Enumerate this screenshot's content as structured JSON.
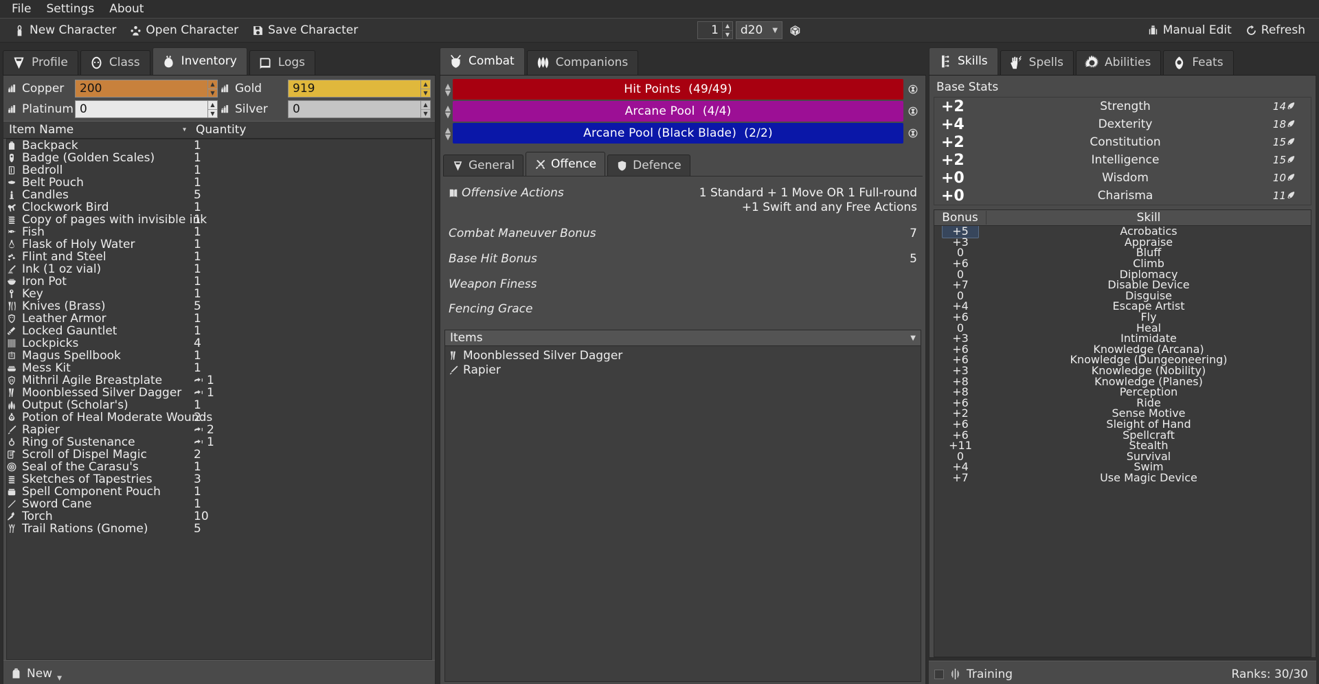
{
  "menubar": {
    "items": [
      {
        "label": "File"
      },
      {
        "label": "Settings"
      },
      {
        "label": "About"
      }
    ]
  },
  "toolbar": {
    "new_character": "New Character",
    "open_character": "Open Character",
    "save_character": "Save Character",
    "dice_count": "1",
    "dice_type": "d20",
    "manual_edit": "Manual Edit",
    "refresh": "Refresh"
  },
  "left_panel": {
    "tabs": [
      {
        "label": "Profile",
        "icon": "helmet-icon",
        "active": false
      },
      {
        "label": "Class",
        "icon": "hood-icon",
        "active": false
      },
      {
        "label": "Inventory",
        "icon": "sack-icon",
        "active": true
      },
      {
        "label": "Logs",
        "icon": "book-icon",
        "active": false
      }
    ],
    "currency": [
      {
        "label": "Copper",
        "value": "200",
        "color": "#c8813c",
        "icon": "coins-icon"
      },
      {
        "label": "Gold",
        "value": "919",
        "color": "#e0b83c",
        "icon": "coins-icon"
      },
      {
        "label": "Platinum",
        "value": "0",
        "color": "#e8e8e8",
        "icon": "coins-icon"
      },
      {
        "label": "Silver",
        "value": "0",
        "color": "#c4c4c4",
        "icon": "coins-icon"
      }
    ],
    "columns": {
      "name": "Item Name",
      "quantity": "Quantity"
    },
    "items": [
      {
        "name": "Backpack",
        "qty": "1",
        "equipped": false,
        "icon": "backpack-icon"
      },
      {
        "name": "Badge (Golden Scales)",
        "qty": "1",
        "equipped": false,
        "icon": "badge-icon"
      },
      {
        "name": "Bedroll",
        "qty": "1",
        "equipped": false,
        "icon": "bedroll-icon"
      },
      {
        "name": "Belt Pouch",
        "qty": "1",
        "equipped": false,
        "icon": "pouch-icon"
      },
      {
        "name": "Candles",
        "qty": "5",
        "equipped": false,
        "icon": "candle-icon"
      },
      {
        "name": "Clockwork Bird",
        "qty": "1",
        "equipped": false,
        "icon": "bird-icon"
      },
      {
        "name": "Copy of pages with invisible ink",
        "qty": "1",
        "equipped": false,
        "icon": "pages-icon"
      },
      {
        "name": "Fish",
        "qty": "1",
        "equipped": false,
        "icon": "fish-icon"
      },
      {
        "name": "Flask of Holy Water",
        "qty": "1",
        "equipped": false,
        "icon": "flask-icon"
      },
      {
        "name": "Flint and Steel",
        "qty": "1",
        "equipped": false,
        "icon": "flint-icon"
      },
      {
        "name": "Ink (1 oz vial)",
        "qty": "1",
        "equipped": false,
        "icon": "ink-icon"
      },
      {
        "name": "Iron Pot",
        "qty": "1",
        "equipped": false,
        "icon": "pot-icon"
      },
      {
        "name": "Key",
        "qty": "1",
        "equipped": false,
        "icon": "key-icon"
      },
      {
        "name": "Knives (Brass)",
        "qty": "5",
        "equipped": false,
        "icon": "knives-icon"
      },
      {
        "name": "Leather Armor",
        "qty": "1",
        "equipped": false,
        "icon": "armor-icon"
      },
      {
        "name": "Locked Gauntlet",
        "qty": "1",
        "equipped": false,
        "icon": "gauntlet-icon"
      },
      {
        "name": "Lockpicks",
        "qty": "4",
        "equipped": false,
        "icon": "lockpicks-icon"
      },
      {
        "name": "Magus Spellbook",
        "qty": "1",
        "equipped": false,
        "icon": "spellbook-icon"
      },
      {
        "name": "Mess Kit",
        "qty": "1",
        "equipped": false,
        "icon": "messkit-icon"
      },
      {
        "name": "Mithril Agile Breastplate",
        "qty": "1",
        "equipped": true,
        "icon": "breastplate-icon"
      },
      {
        "name": "Moonblessed Silver Dagger",
        "qty": "1",
        "equipped": true,
        "icon": "dagger-icon"
      },
      {
        "name": "Output (Scholar's)",
        "qty": "1",
        "equipped": false,
        "icon": "quill-icon"
      },
      {
        "name": "Potion of Heal Moderate Wounds",
        "qty": "2",
        "equipped": false,
        "icon": "potion-icon"
      },
      {
        "name": "Rapier",
        "qty": "2",
        "equipped": true,
        "icon": "rapier-icon"
      },
      {
        "name": "Ring of Sustenance",
        "qty": "1",
        "equipped": true,
        "icon": "ring-icon"
      },
      {
        "name": "Scroll of Dispel Magic",
        "qty": "2",
        "equipped": false,
        "icon": "scroll-icon"
      },
      {
        "name": "Seal of the Carasu's",
        "qty": "1",
        "equipped": false,
        "icon": "seal-icon"
      },
      {
        "name": "Sketches of Tapestries",
        "qty": "3",
        "equipped": false,
        "icon": "pages-icon"
      },
      {
        "name": "Spell Component Pouch",
        "qty": "1",
        "equipped": false,
        "icon": "component-pouch-icon"
      },
      {
        "name": "Sword Cane",
        "qty": "1",
        "equipped": false,
        "icon": "cane-icon"
      },
      {
        "name": "Torch",
        "qty": "10",
        "equipped": false,
        "icon": "torch-icon"
      },
      {
        "name": "Trail Rations (Gnome)",
        "qty": "5",
        "equipped": false,
        "icon": "rations-icon"
      }
    ],
    "new_button": "New"
  },
  "mid_panel": {
    "tabs": [
      {
        "label": "Combat",
        "icon": "shield-swords-icon",
        "active": true
      },
      {
        "label": "Companions",
        "icon": "leaves-icon",
        "active": false
      }
    ],
    "resources": [
      {
        "label": "Hit Points",
        "value": "(49/49)",
        "color": "#a80010"
      },
      {
        "label": "Arcane Pool",
        "value": "(4/4)",
        "color": "#9c0f95"
      },
      {
        "label": "Arcane Pool (Black Blade)",
        "value": "(2/2)",
        "color": "#0a17a8"
      }
    ],
    "sub_tabs": [
      {
        "label": "General",
        "icon": "helmet-icon",
        "active": false
      },
      {
        "label": "Offence",
        "icon": "swords-icon",
        "active": true
      },
      {
        "label": "Defence",
        "icon": "shield-icon",
        "active": false
      }
    ],
    "offence_rows": [
      {
        "label": "Offensive Actions",
        "value": "1 Standard + 1 Move OR 1 Full-round\n+1 Swift and any Free Actions",
        "icon": "book-icon"
      },
      {
        "label": "Combat Maneuver Bonus",
        "value": "7",
        "icon": ""
      },
      {
        "label": "Base Hit Bonus",
        "value": "5",
        "icon": ""
      },
      {
        "label": "Weapon Finess",
        "value": "",
        "icon": ""
      },
      {
        "label": "Fencing Grace",
        "value": "",
        "icon": ""
      }
    ],
    "items_group": {
      "title": "Items",
      "entries": [
        {
          "name": "Moonblessed Silver Dagger",
          "icon": "dagger-icon"
        },
        {
          "name": "Rapier",
          "icon": "rapier-icon"
        }
      ]
    }
  },
  "right_panel": {
    "tabs": [
      {
        "label": "Skills",
        "icon": "skills-icon",
        "active": true
      },
      {
        "label": "Spells",
        "icon": "spell-hand-icon",
        "active": false
      },
      {
        "label": "Abilities",
        "icon": "abilities-icon",
        "active": false
      },
      {
        "label": "Feats",
        "icon": "feats-icon",
        "active": false
      }
    ],
    "base_stats_title": "Base Stats",
    "base_stats": [
      {
        "mod": "+2",
        "name": "Strength",
        "score": "14"
      },
      {
        "mod": "+4",
        "name": "Dexterity",
        "score": "18"
      },
      {
        "mod": "+2",
        "name": "Constitution",
        "score": "15"
      },
      {
        "mod": "+2",
        "name": "Intelligence",
        "score": "15"
      },
      {
        "mod": "+0",
        "name": "Wisdom",
        "score": "10"
      },
      {
        "mod": "+0",
        "name": "Charisma",
        "score": "11"
      }
    ],
    "skill_columns": {
      "bonus": "Bonus",
      "skill": "Skill"
    },
    "skills": [
      {
        "bonus": "+5",
        "name": "Acrobatics",
        "selected": true
      },
      {
        "bonus": "+3",
        "name": "Appraise",
        "selected": false
      },
      {
        "bonus": "0",
        "name": "Bluff",
        "selected": false
      },
      {
        "bonus": "+6",
        "name": "Climb",
        "selected": false
      },
      {
        "bonus": "0",
        "name": "Diplomacy",
        "selected": false
      },
      {
        "bonus": "+7",
        "name": "Disable Device",
        "selected": false
      },
      {
        "bonus": "0",
        "name": "Disguise",
        "selected": false
      },
      {
        "bonus": "+4",
        "name": "Escape Artist",
        "selected": false
      },
      {
        "bonus": "+6",
        "name": "Fly",
        "selected": false
      },
      {
        "bonus": "0",
        "name": "Heal",
        "selected": false
      },
      {
        "bonus": "+3",
        "name": "Intimidate",
        "selected": false
      },
      {
        "bonus": "+6",
        "name": "Knowledge (Arcana)",
        "selected": false
      },
      {
        "bonus": "+6",
        "name": "Knowledge (Dungeoneering)",
        "selected": false
      },
      {
        "bonus": "+3",
        "name": "Knowledge (Nobility)",
        "selected": false
      },
      {
        "bonus": "+8",
        "name": "Knowledge (Planes)",
        "selected": false
      },
      {
        "bonus": "+8",
        "name": "Perception",
        "selected": false
      },
      {
        "bonus": "+6",
        "name": "Ride",
        "selected": false
      },
      {
        "bonus": "+2",
        "name": "Sense Motive",
        "selected": false
      },
      {
        "bonus": "+6",
        "name": "Sleight of Hand",
        "selected": false
      },
      {
        "bonus": "+6",
        "name": "Spellcraft",
        "selected": false
      },
      {
        "bonus": "+11",
        "name": "Stealth",
        "selected": false
      },
      {
        "bonus": "0",
        "name": "Survival",
        "selected": false
      },
      {
        "bonus": "+4",
        "name": "Swim",
        "selected": false
      },
      {
        "bonus": "+7",
        "name": "Use Magic Device",
        "selected": false
      }
    ],
    "training_label": "Training",
    "ranks_label": "Ranks: 30/30"
  }
}
